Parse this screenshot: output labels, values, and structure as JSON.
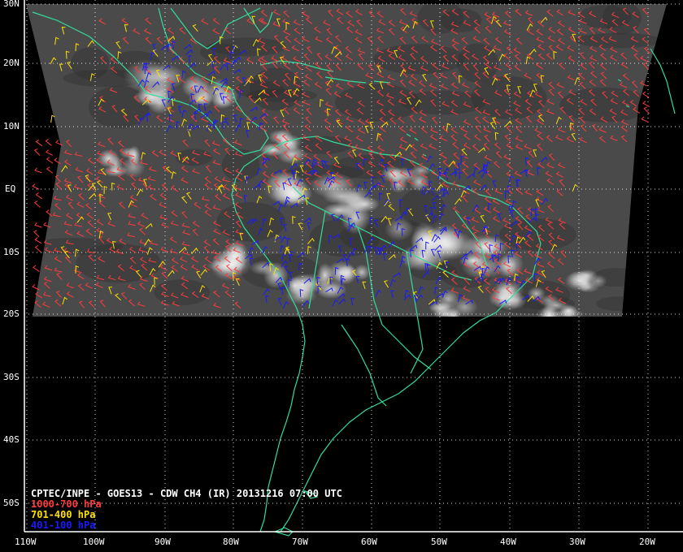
{
  "title": "CPTEC/INPE - GOES13 - CDW CH4 (IR) 20131216 07:00 UTC",
  "legend": [
    {
      "label": "1000-700 hPa",
      "color": "#ff3b3b"
    },
    {
      "label": "701-400 hPa",
      "color": "#ffe000"
    },
    {
      "label": "401-100 hPa",
      "color": "#1a1aff"
    }
  ],
  "lat_labels": [
    "30N",
    "20N",
    "10N",
    "EQ",
    "10S",
    "20S",
    "30S",
    "40S",
    "50S"
  ],
  "lon_labels": [
    "110W",
    "100W",
    "90W",
    "80W",
    "70W",
    "60W",
    "50W",
    "40W",
    "30W",
    "20W"
  ],
  "colors": {
    "coast": "#33dd99",
    "grid": "#ffffff",
    "background": "#000000"
  }
}
